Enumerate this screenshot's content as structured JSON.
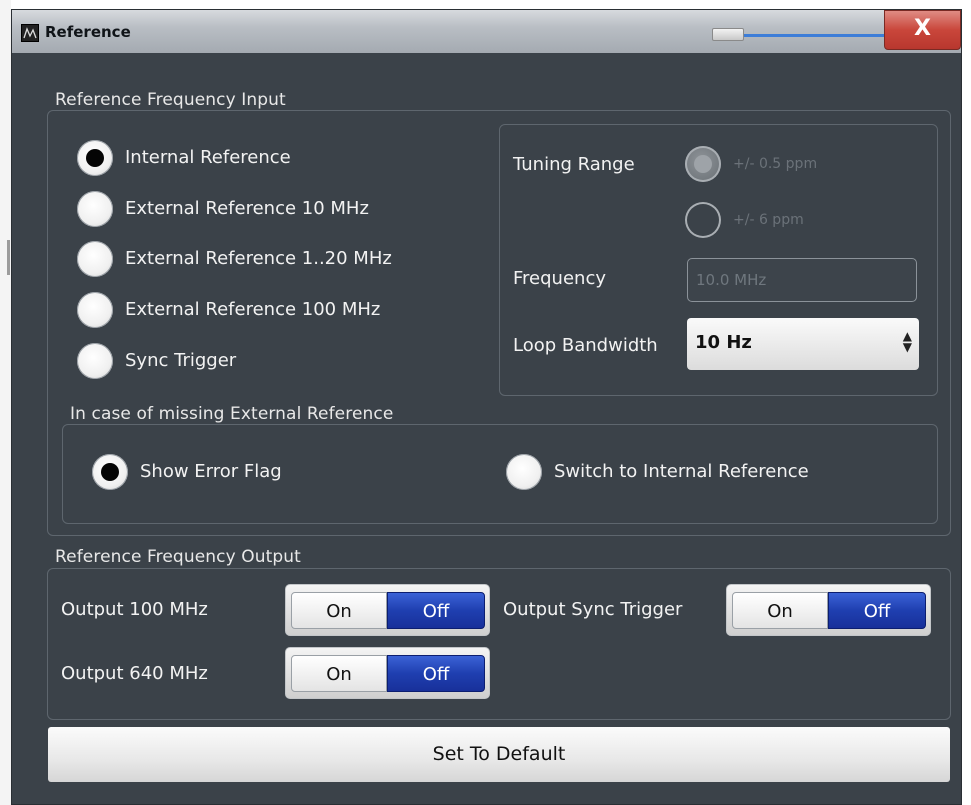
{
  "window": {
    "title": "Reference",
    "close_label": "X"
  },
  "reference_input": {
    "group_label": "Reference Frequency Input",
    "options": [
      {
        "label": "Internal Reference",
        "selected": true
      },
      {
        "label": "External Reference 10 MHz",
        "selected": false
      },
      {
        "label": "External Reference 1..20 MHz",
        "selected": false
      },
      {
        "label": "External Reference 100 MHz",
        "selected": false
      },
      {
        "label": "Sync Trigger",
        "selected": false
      }
    ],
    "tuning_range": {
      "label": "Tuning Range",
      "options": [
        {
          "label": "+/- 0.5 ppm",
          "selected": true
        },
        {
          "label": "+/- 6 ppm",
          "selected": false
        }
      ]
    },
    "frequency": {
      "label": "Frequency",
      "value": "10.0 MHz"
    },
    "loop_bandwidth": {
      "label": "Loop Bandwidth",
      "value": "10 Hz"
    }
  },
  "missing_reference": {
    "group_label": "In case of missing External Reference",
    "options": [
      {
        "label": "Show Error Flag",
        "selected": true
      },
      {
        "label": "Switch to Internal Reference",
        "selected": false
      }
    ]
  },
  "reference_output": {
    "group_label": "Reference Frequency Output",
    "outputs": [
      {
        "label": "Output 100 MHz",
        "on_label": "On",
        "off_label": "Off",
        "state": "Off"
      },
      {
        "label": "Output Sync Trigger",
        "on_label": "On",
        "off_label": "Off",
        "state": "Off"
      },
      {
        "label": "Output 640 MHz",
        "on_label": "On",
        "off_label": "Off",
        "state": "Off"
      }
    ]
  },
  "buttons": {
    "set_default": "Set To Default"
  },
  "colors": {
    "panel_bg": "#3b4249",
    "toggle_active": "#1f3fb0",
    "close_button": "#c9463b"
  }
}
